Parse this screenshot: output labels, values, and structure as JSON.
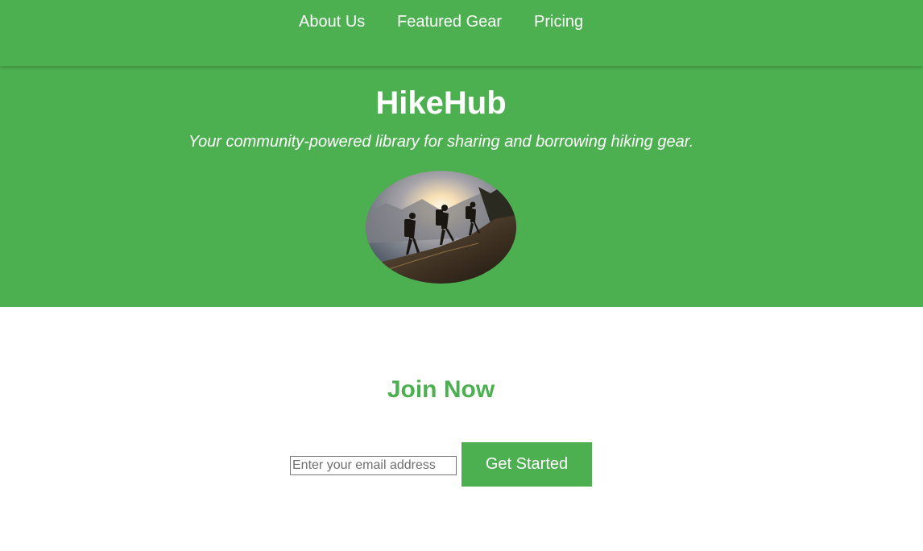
{
  "nav": {
    "items": [
      {
        "label": "About Us"
      },
      {
        "label": "Featured Gear"
      },
      {
        "label": "Pricing"
      }
    ]
  },
  "hero": {
    "title": "HikeHub",
    "tagline": "Your community-powered library for sharing and borrowing hiking gear.",
    "image_alt": "hikers-on-mountain-ridge-at-sunrise"
  },
  "join": {
    "title": "Join Now",
    "email_placeholder": "Enter your email address",
    "button_label": "Get Started"
  },
  "colors": {
    "brand_green": "#4caf50",
    "background": "#ffffff",
    "text_on_brand": "#ffffff"
  }
}
